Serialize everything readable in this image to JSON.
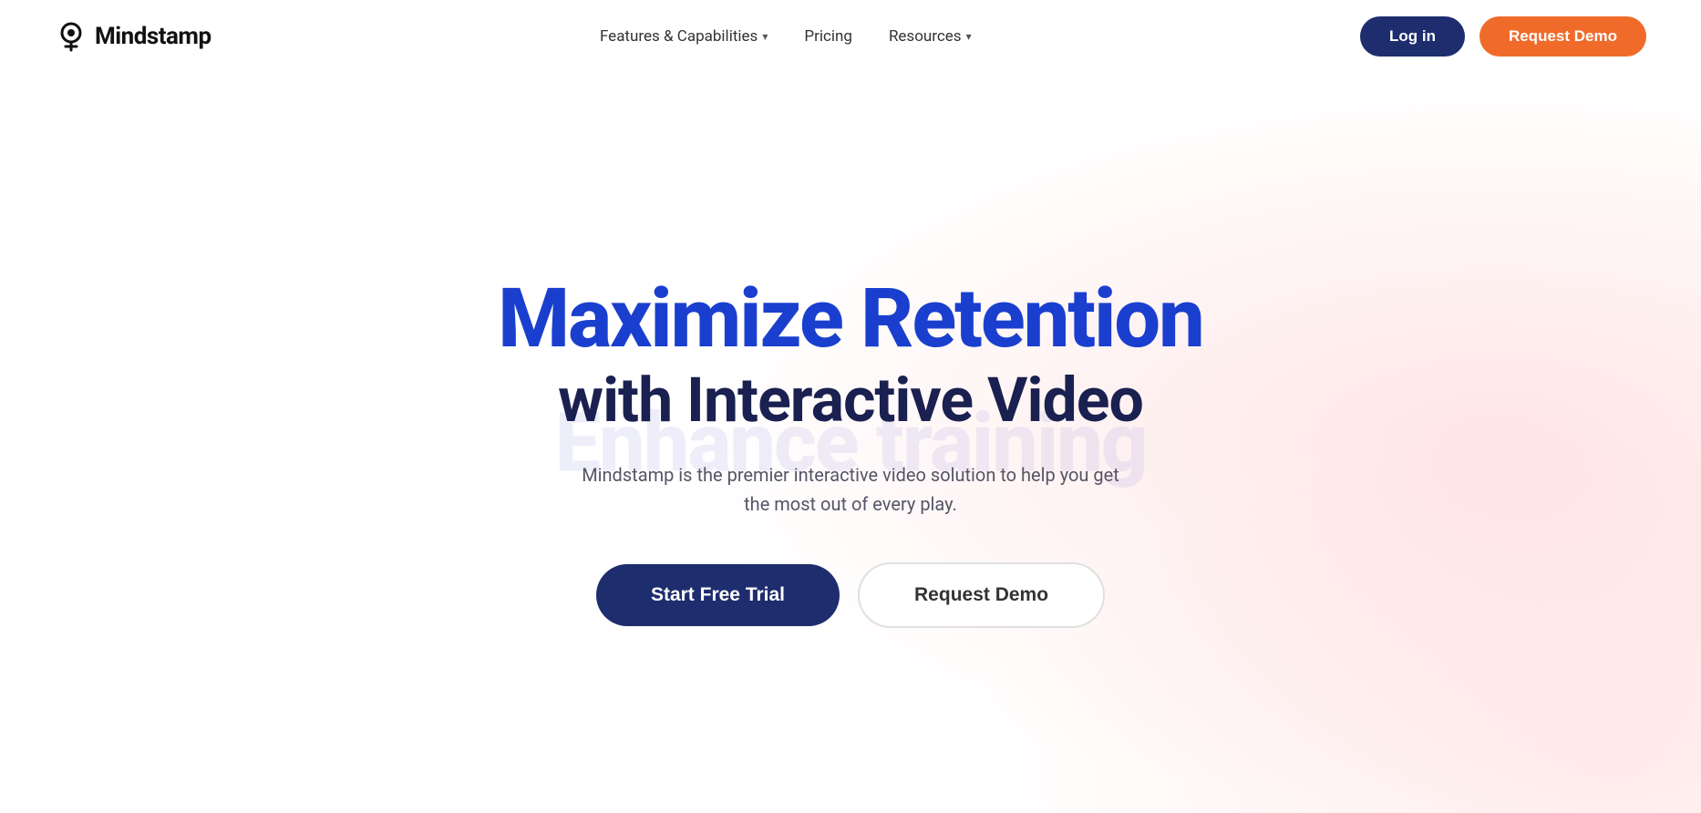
{
  "brand": {
    "name": "Mindstamp",
    "logo_icon_alt": "mindstamp-logo-icon"
  },
  "navbar": {
    "features_label": "Features & Capabilities",
    "pricing_label": "Pricing",
    "resources_label": "Resources",
    "login_label": "Log in",
    "demo_label": "Request Demo"
  },
  "hero": {
    "title_main": "Maximize Retention",
    "title_sub": "with Interactive Video",
    "ghost_text": "Enhance training",
    "description": "Mindstamp is the premier interactive video solution to help you get the most out of every play.",
    "cta_trial": "Start Free Trial",
    "cta_demo": "Request Demo"
  }
}
